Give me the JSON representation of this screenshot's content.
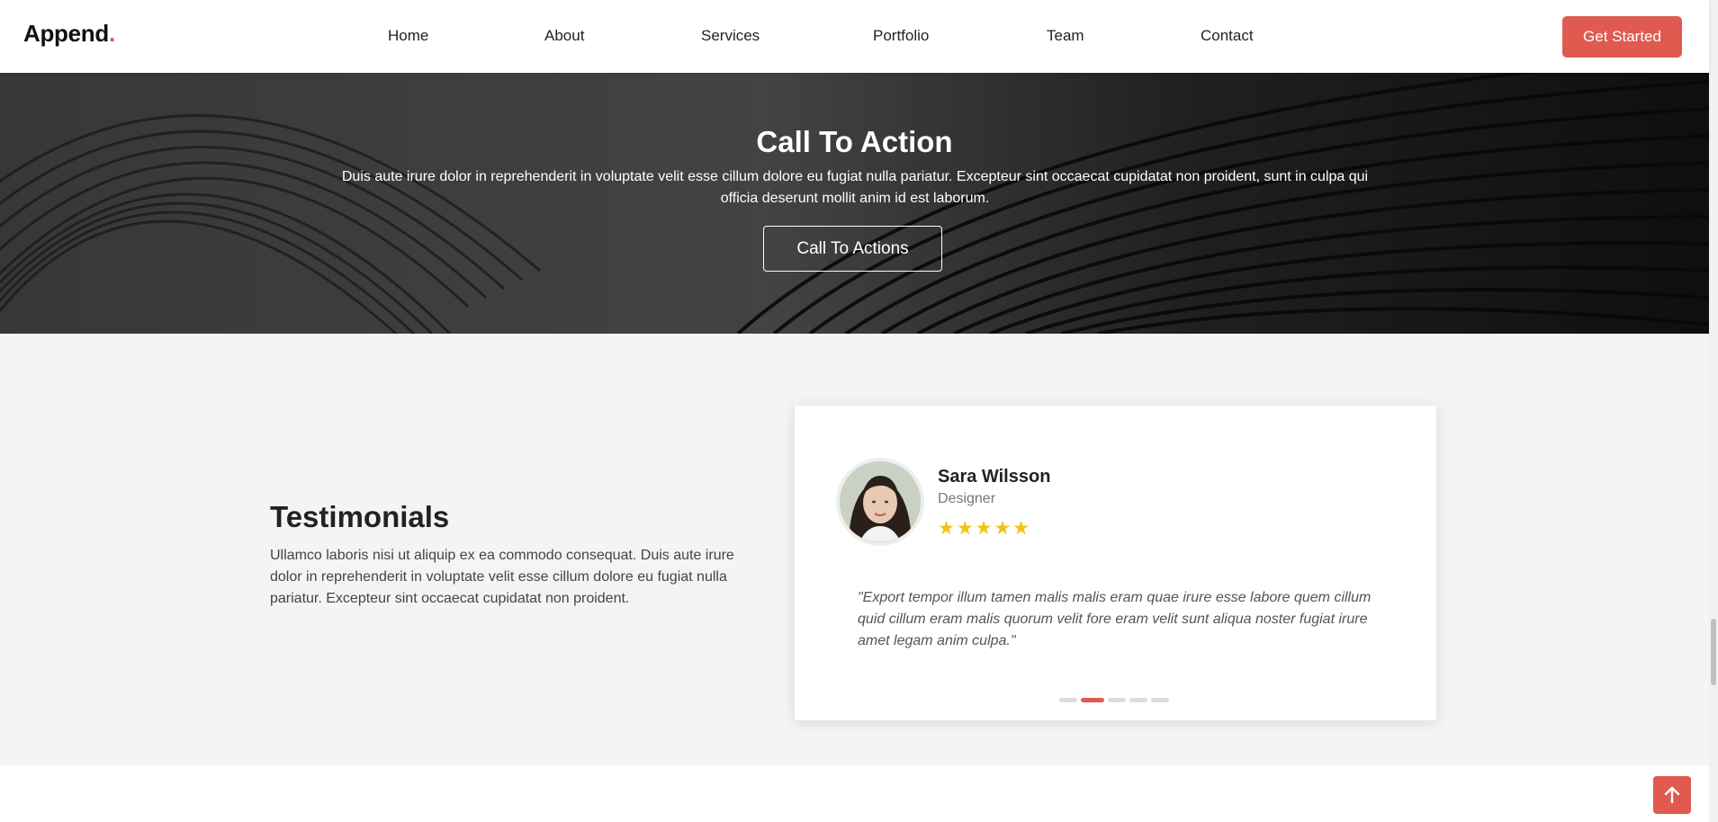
{
  "header": {
    "logo": "Append",
    "logo_dot": ".",
    "nav": [
      "Home",
      "About",
      "Services",
      "Portfolio",
      "Team",
      "Contact"
    ],
    "cta_button": "Get Started"
  },
  "cta": {
    "title": "Call To Action",
    "text": "Duis aute irure dolor in reprehenderit in voluptate velit esse cillum dolore eu fugiat nulla pariatur. Excepteur sint occaecat cupidatat non proident, sunt in culpa qui officia deserunt mollit anim id est laborum.",
    "button": "Call To Actions"
  },
  "testimonials": {
    "title": "Testimonials",
    "description": "Ullamco laboris nisi ut aliquip ex ea commodo consequat. Duis aute irure dolor in reprehenderit in voluptate velit esse cillum dolore eu fugiat nulla pariatur. Excepteur sint occaecat cupidatat non proident.",
    "card": {
      "name": "Sara Wilsson",
      "role": "Designer",
      "stars": "★★★★★",
      "rating": 5,
      "quote": "\"Export tempor illum tamen malis malis eram quae irure esse labore quem cillum quid cillum eram malis quorum velit fore eram velit sunt aliqua noster fugiat irure amet legam anim culpa.\""
    },
    "pagination": {
      "total": 5,
      "active": 2
    }
  },
  "colors": {
    "accent": "#e05a50",
    "star": "#f1c40f",
    "section_bg": "#f4f4f4"
  },
  "icons": {
    "back_to_top": "arrow-up-icon"
  }
}
